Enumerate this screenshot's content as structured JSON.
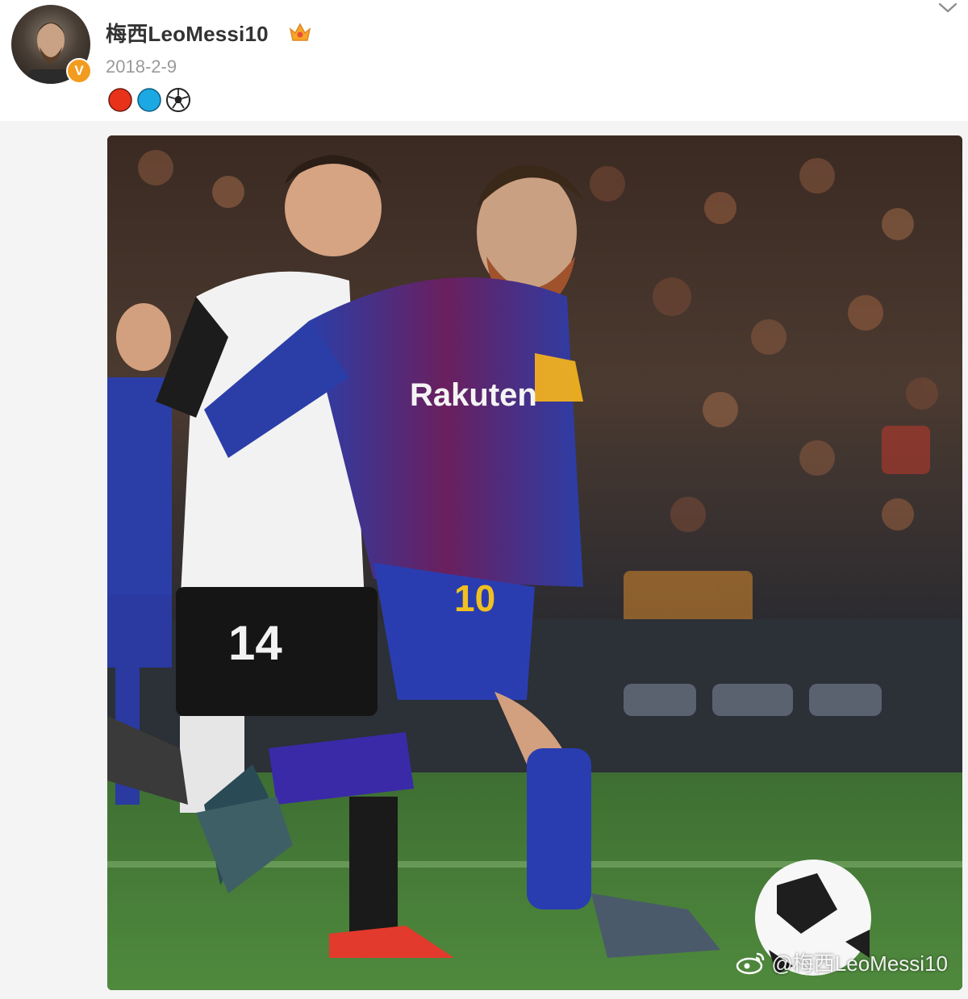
{
  "post": {
    "author": "梅西LeoMessi10",
    "date": "2018-2-9",
    "verified_badge": "V",
    "emojis": [
      "red-circle-emoji",
      "blue-circle-emoji",
      "soccer-ball-emoji"
    ],
    "media": {
      "watermark": "@梅西LeoMessi10",
      "jersey_numbers": [
        "14",
        "10"
      ],
      "shirt_sponsor": "Rakuten"
    }
  },
  "colors": {
    "username": "#333333",
    "date": "#9a9a9a",
    "verified": "#f29c1f",
    "band": "#f4f4f4"
  }
}
